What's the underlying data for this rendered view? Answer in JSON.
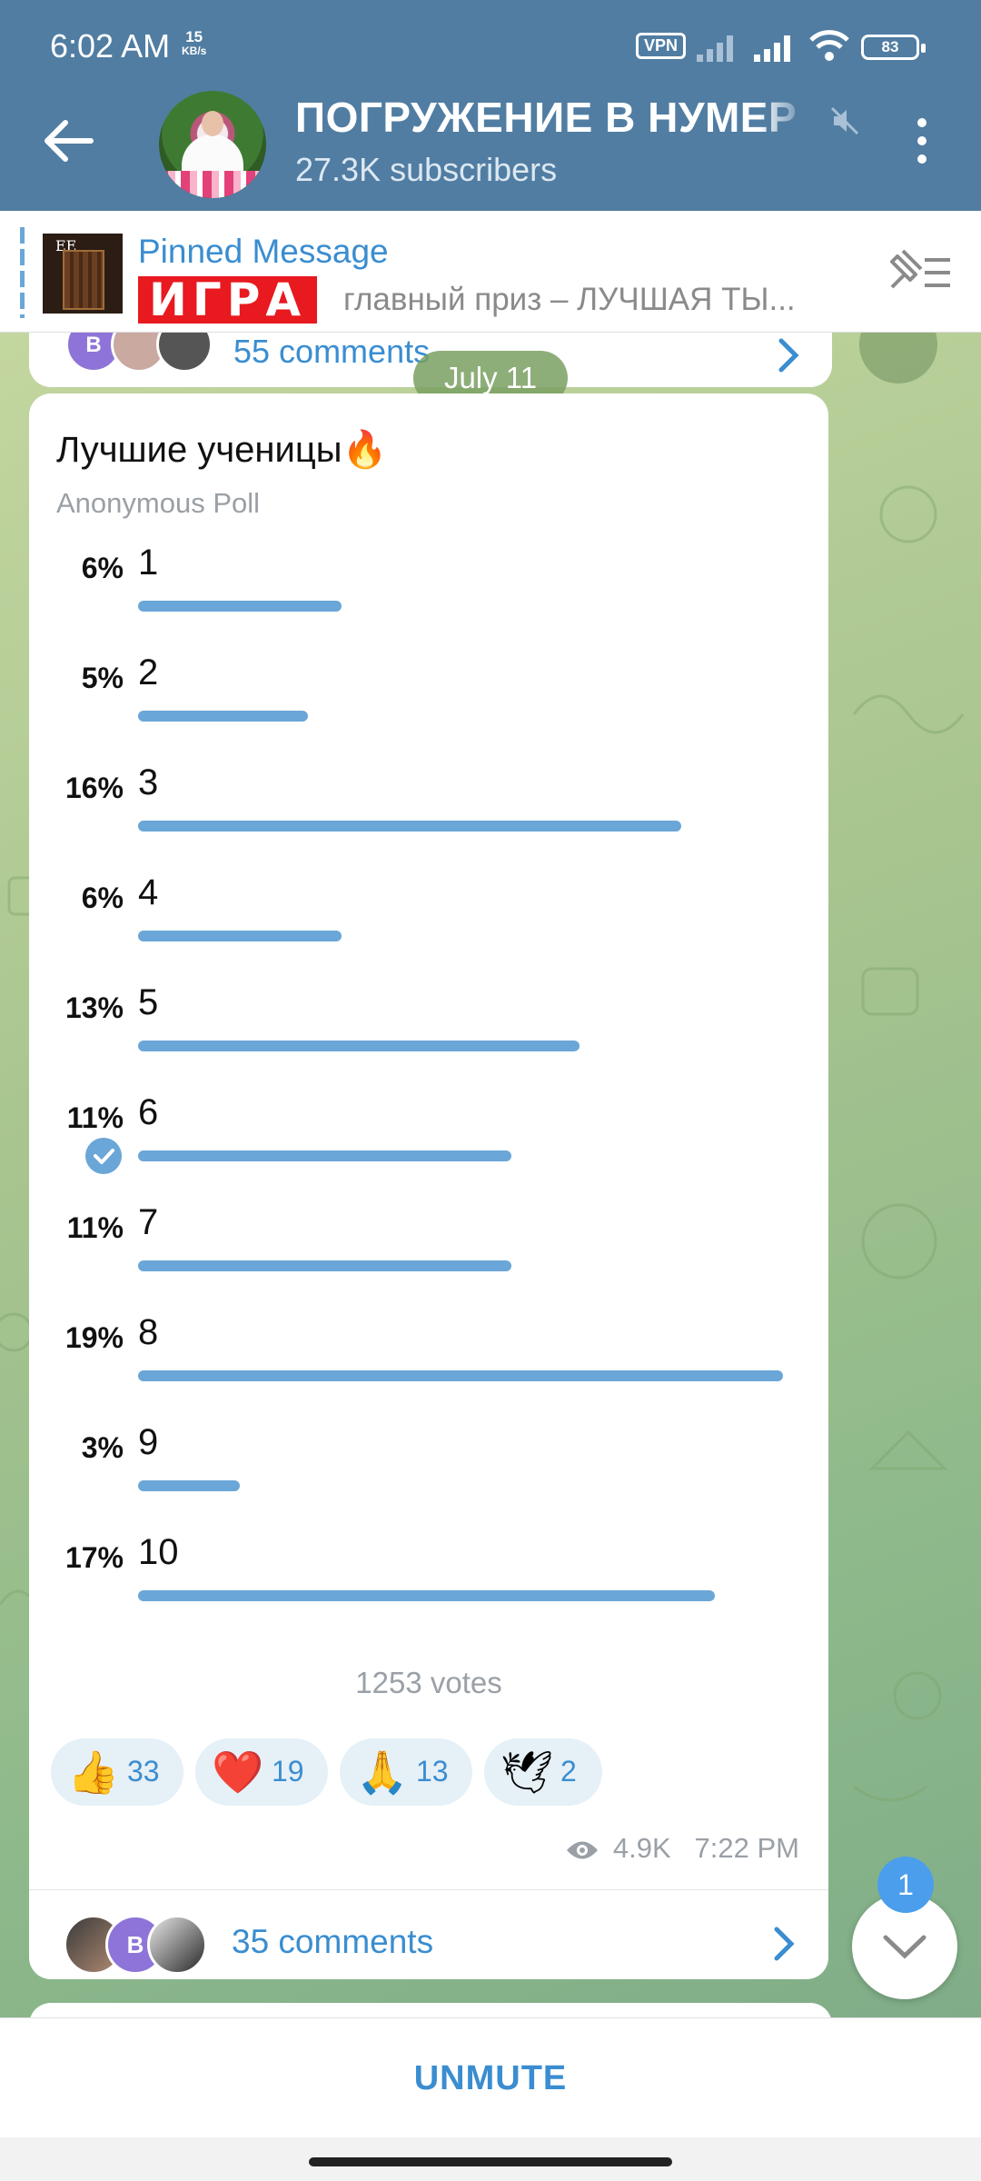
{
  "status_bar": {
    "time": "6:02 AM",
    "speed_value": "15",
    "speed_unit": "KB/s",
    "vpn": "VPN",
    "battery": "83"
  },
  "header": {
    "channel_name": "ПОГРУЖЕНИЕ В НУМЕР",
    "subscribers": "27.3K subscribers"
  },
  "pinned": {
    "title": "Pinned Message",
    "highlight": "ИГРА",
    "preview": "главный приз – ЛУЧШАЯ ТЫ..."
  },
  "previous_post": {
    "comments": "55 comments"
  },
  "date_separator": "July 11",
  "poll": {
    "question": "Лучшие ученицы🔥",
    "type": "Anonymous Poll",
    "options": [
      {
        "label": "1",
        "percent": "6%",
        "value": 6
      },
      {
        "label": "2",
        "percent": "5%",
        "value": 5
      },
      {
        "label": "3",
        "percent": "16%",
        "value": 16
      },
      {
        "label": "4",
        "percent": "6%",
        "value": 6
      },
      {
        "label": "5",
        "percent": "13%",
        "value": 13
      },
      {
        "label": "6",
        "percent": "11%",
        "value": 11,
        "chosen": true
      },
      {
        "label": "7",
        "percent": "11%",
        "value": 11
      },
      {
        "label": "8",
        "percent": "19%",
        "value": 19
      },
      {
        "label": "9",
        "percent": "3%",
        "value": 3
      },
      {
        "label": "10",
        "percent": "17%",
        "value": 17
      }
    ],
    "votes": "1253 votes"
  },
  "reactions": [
    {
      "emoji": "👍",
      "count": "33"
    },
    {
      "emoji": "❤️",
      "count": "19"
    },
    {
      "emoji": "🙏",
      "count": "13"
    },
    {
      "emoji": "🕊",
      "count": "2"
    }
  ],
  "post_meta": {
    "views": "4.9K",
    "time": "7:22 PM"
  },
  "comments": {
    "label": "35 comments",
    "avatar_letter": "В"
  },
  "scroll_badge": "1",
  "bottom": {
    "unmute": "UNMUTE"
  },
  "colors": {
    "header": "#517da2",
    "accent": "#3a8dd0",
    "bar": "#6aa6d8",
    "pinned_highlight": "#e8191f"
  }
}
